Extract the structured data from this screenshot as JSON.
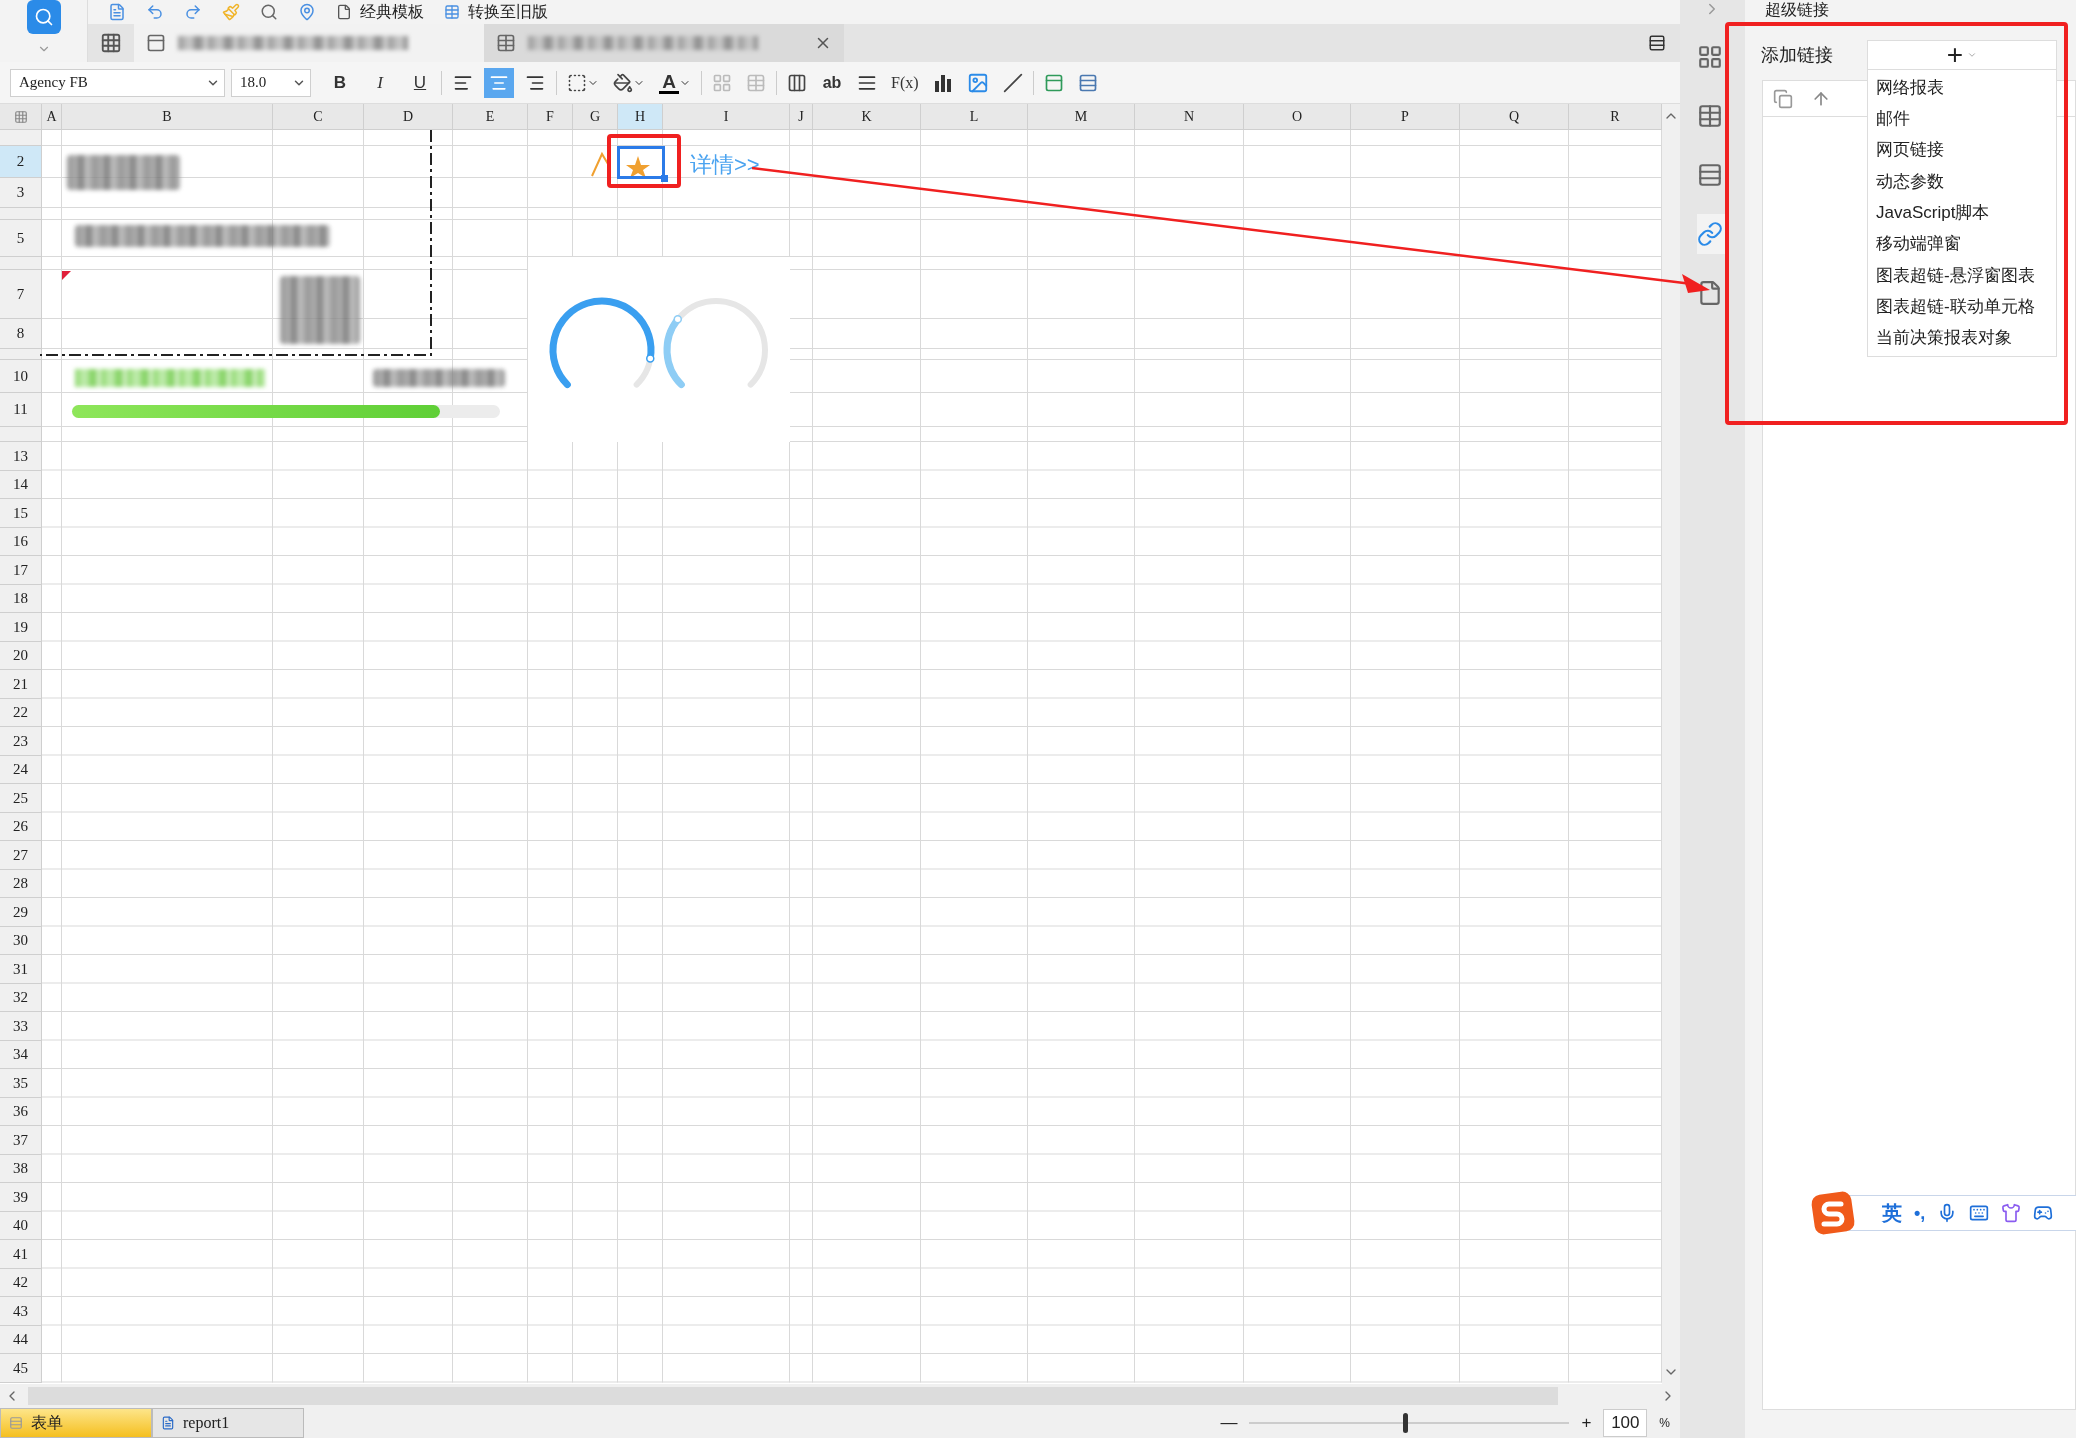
{
  "toolbar": {
    "buttons": [
      "经典模板",
      "转换至旧版"
    ]
  },
  "document_tabs": [
    {
      "selected": true
    },
    {
      "selected": false
    }
  ],
  "format_bar": {
    "font": "Agency FB",
    "size": "18.0",
    "styles": [
      "B",
      "I",
      "U"
    ],
    "align": [
      {
        "selected": false
      },
      {
        "selected": true
      },
      {
        "selected": false
      }
    ],
    "font_color": {
      "glyph": "A",
      "color": "#000000"
    },
    "glyphs": [
      "ab",
      "F(x)"
    ]
  },
  "sheet": {
    "columns": [
      {
        "label": "A",
        "selected": false
      },
      {
        "label": "B",
        "selected": false
      },
      {
        "label": "C",
        "selected": false
      },
      {
        "label": "D",
        "selected": false
      },
      {
        "label": "E",
        "selected": false
      },
      {
        "label": "F",
        "selected": false
      },
      {
        "label": "G",
        "selected": false
      },
      {
        "label": "H",
        "selected": true
      },
      {
        "label": "I",
        "selected": false
      },
      {
        "label": "J",
        "selected": false
      },
      {
        "label": "K",
        "selected": false
      },
      {
        "label": "L",
        "selected": false
      },
      {
        "label": "M",
        "selected": false
      },
      {
        "label": "N",
        "selected": false
      },
      {
        "label": "O",
        "selected": false
      },
      {
        "label": "P",
        "selected": false
      },
      {
        "label": "Q",
        "selected": false
      },
      {
        "label": "R",
        "selected": false
      }
    ],
    "rows": [
      {
        "label": "2",
        "selected": true
      },
      {
        "label": "3",
        "selected": false
      },
      {
        "label": "5",
        "selected": false
      },
      {
        "label": "7",
        "selected": false
      },
      {
        "label": "8",
        "selected": false
      },
      {
        "label": "10",
        "selected": false
      },
      {
        "label": "11",
        "selected": false
      },
      {
        "label": "13",
        "selected": false
      },
      {
        "label": "14",
        "selected": false
      },
      {
        "label": "15",
        "selected": false
      },
      {
        "label": "16",
        "selected": false
      },
      {
        "label": "17",
        "selected": false
      },
      {
        "label": "18",
        "selected": false
      },
      {
        "label": "19",
        "selected": false
      },
      {
        "label": "20",
        "selected": false
      },
      {
        "label": "21",
        "selected": false
      },
      {
        "label": "22",
        "selected": false
      },
      {
        "label": "23",
        "selected": false
      },
      {
        "label": "24",
        "selected": false
      },
      {
        "label": "25",
        "selected": false
      },
      {
        "label": "26",
        "selected": false
      },
      {
        "label": "27",
        "selected": false
      },
      {
        "label": "28",
        "selected": false
      },
      {
        "label": "29",
        "selected": false
      },
      {
        "label": "30",
        "selected": false
      },
      {
        "label": "31",
        "selected": false
      },
      {
        "label": "32",
        "selected": false
      },
      {
        "label": "33",
        "selected": false
      },
      {
        "label": "34",
        "selected": false
      },
      {
        "label": "35",
        "selected": false
      },
      {
        "label": "36",
        "selected": false
      },
      {
        "label": "37",
        "selected": false
      },
      {
        "label": "38",
        "selected": false
      },
      {
        "label": "39",
        "selected": false
      },
      {
        "label": "40",
        "selected": false
      },
      {
        "label": "41",
        "selected": false
      },
      {
        "label": "42",
        "selected": false
      },
      {
        "label": "43",
        "selected": false
      },
      {
        "label": "44",
        "selected": false
      },
      {
        "label": "45",
        "selected": false
      }
    ],
    "link_text": "详情>>",
    "progress": {
      "level": 0.86
    },
    "gauges": [
      {
        "color": "#3a9ff0"
      },
      {
        "color": "#8ecdf5"
      }
    ]
  },
  "panel": {
    "title": "超级链接",
    "add_label": "添加链接",
    "add_glyph": "+",
    "side_icons": [
      {
        "selected": false
      },
      {
        "selected": false
      },
      {
        "selected": false
      },
      {
        "selected": true
      },
      {
        "selected": false
      }
    ],
    "menu": [
      "网络报表",
      "邮件",
      "网页链接",
      "动态参数",
      "JavaScript脚本",
      "移动端弹窗",
      "图表超链-悬浮窗图表",
      "图表超链-联动单元格",
      "当前决策报表对象"
    ]
  },
  "sheet_tabs": [
    {
      "label": "表单",
      "selected": true
    },
    {
      "label": "report1",
      "selected": false
    }
  ],
  "zoom": {
    "minus": "—",
    "plus": "+",
    "value": "100",
    "unit": "%",
    "level": 0.48
  },
  "ime": {
    "mode": "英",
    "punctuation": "•,"
  }
}
